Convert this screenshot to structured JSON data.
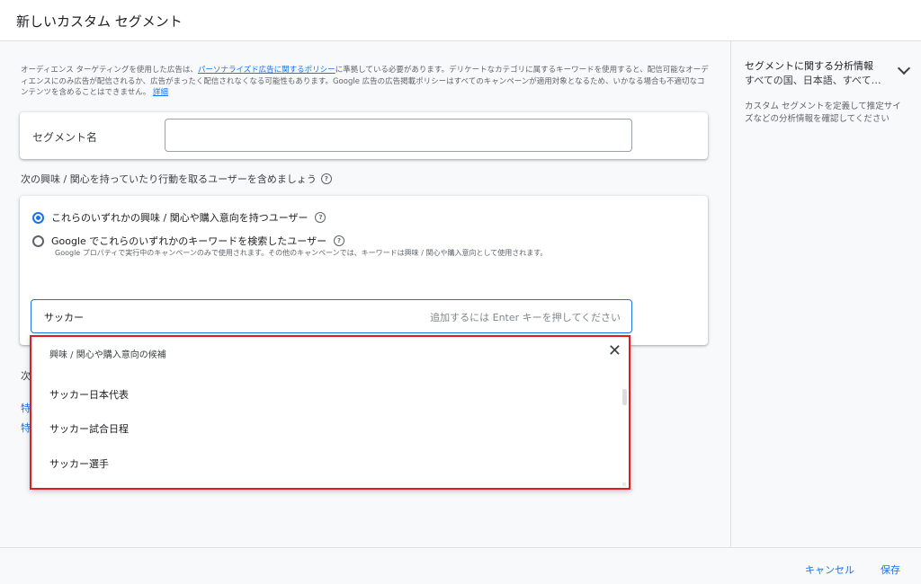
{
  "dialog": {
    "title": "新しいカスタム セグメント"
  },
  "notice": {
    "text_before": "オーディエンス ターゲティングを使用した広告は、",
    "policy_link": "パーソナライズド広告に関するポリシー",
    "text_after": "に準拠している必要があります。デリケートなカテゴリに属するキーワードを使用すると、配信可能なオーディエンスにのみ広告が配信されるか、広告がまったく配信されなくなる可能性もあります。Google 広告の広告掲載ポリシーはすべてのキャンペーンが適用対象となるため、いかなる場合も不適切なコンテンツを含めることはできません。",
    "details_link": "詳細"
  },
  "segment_name": {
    "label": "セグメント名",
    "value": ""
  },
  "include": {
    "heading": "次の興味 / 関心を持っていたり行動を取るユーザーを含めましょう",
    "options": [
      {
        "label": "これらのいずれかの興味 / 関心や購入意向を持つユーザー",
        "selected": true
      },
      {
        "label": "Google でこれらのいずれかのキーワードを検索したユーザー",
        "selected": false,
        "subtext": "Google プロパティで実行中のキャンペーンのみで使用されます。その他のキャンペーンでは、キーワードは興味 / 関心や購入意向として使用されます。"
      }
    ],
    "keyword_input": {
      "value": "サッカー",
      "hint": "追加するには Enter キーを押してください"
    }
  },
  "below": {
    "line1": "次",
    "link1": "特",
    "link2": "特"
  },
  "dropdown": {
    "header": "興味 / 関心や購入意向の候補",
    "close_icon": "close-icon",
    "items": [
      "サッカー日本代表",
      "サッカー試合日程",
      "サッカー選手"
    ],
    "border_color": "#e01b24"
  },
  "sidebar": {
    "title": "セグメントに関する分析情報",
    "subtitle": "すべての国、日本語、すべての...",
    "description": "カスタム セグメントを定義して推定サイズなどの分析情報を確認してください"
  },
  "footer": {
    "cancel_label": "キャンセル",
    "save_label": "保存"
  },
  "colors": {
    "accent": "#1a73e8",
    "highlight": "#e01b24"
  }
}
